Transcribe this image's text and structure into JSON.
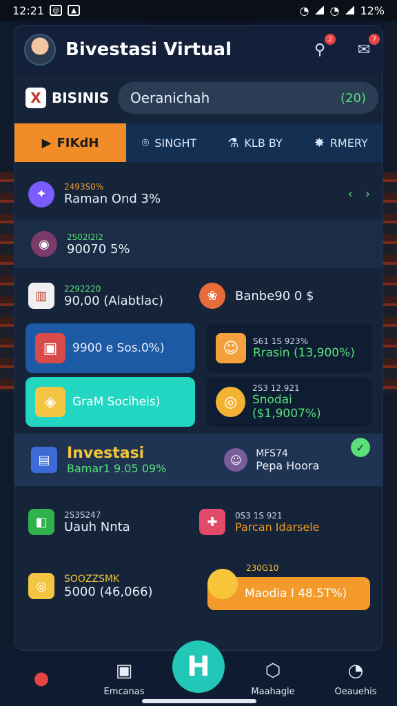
{
  "status": {
    "time": "12:21",
    "battery": "12%"
  },
  "header": {
    "title": "Bivestasi Virtual",
    "notif_count": "2",
    "msg_count": "7"
  },
  "business": {
    "label": "BISINIS",
    "logo": "X"
  },
  "search": {
    "value": "Oeranichah",
    "badge": "(20)"
  },
  "tabs": [
    {
      "label": "FIKdH",
      "icon": "play-icon"
    },
    {
      "label": "SINGHT",
      "icon": "pin-icon"
    },
    {
      "label": "KLB BY",
      "icon": "cart-icon"
    },
    {
      "label": "RMERY",
      "icon": "star-icon"
    }
  ],
  "rows": {
    "r1": {
      "small": "2493S0%",
      "big": "Raman Ond 3%",
      "icon": "compass-icon"
    },
    "r2": {
      "small": "2S02I2I2",
      "big": "90070 5%",
      "icon": "chip-icon"
    },
    "r3a": {
      "small": "2292220",
      "big": "90,00 (Alabtlac)",
      "icon": "bookshelf-icon"
    },
    "r3b": {
      "big": "Banbe90 0  $",
      "icon": "palette-icon"
    }
  },
  "tiles": {
    "t1": "9900 e Sos.0%)",
    "t2_small": "S61 1S 923%",
    "t2": "Rrasin (13,900%)",
    "t3": "GraM Sociheis)",
    "t4_small": "2S3 12.921",
    "t4": "Snodai ($1,9007%)"
  },
  "invest": {
    "title": "Investasi",
    "sub": "Bamar1 9.05 09%",
    "profile_small": "MFS74",
    "profile_big": "Pepa Hoora"
  },
  "rowA": {
    "small_a": "2S3S247",
    "big_a": "Uauh Nnta",
    "small_b": "0S3 1S 921",
    "big_b": "Parcan Idarsele"
  },
  "rowB": {
    "small_a": "SOOZZSMK",
    "big_a": "5000  (46,066)",
    "small_b": "230G10",
    "big_b": "Maodia I 48.5T%)"
  },
  "nav": [
    {
      "label": "",
      "icon": "location-icon"
    },
    {
      "label": "Emcanas",
      "icon": "wallet-icon"
    },
    {
      "label": "",
      "icon": "home-icon"
    },
    {
      "label": "Maahagle",
      "icon": "shield-icon"
    },
    {
      "label": "Oeauehis",
      "icon": "user-icon"
    }
  ]
}
